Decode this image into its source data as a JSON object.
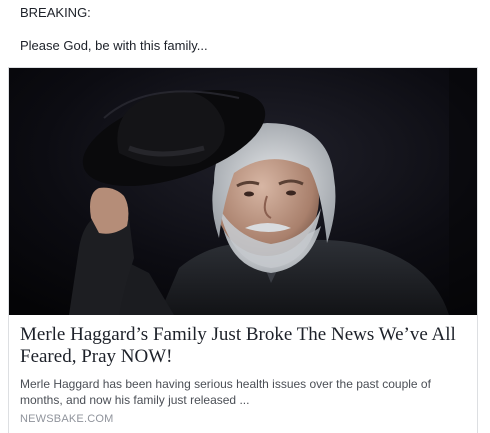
{
  "post": {
    "text_line1": "BREAKING:",
    "text_line2": "Please God, be with this family..."
  },
  "link_card": {
    "image_icon": "photo-icon",
    "title": "Merle Haggard’s Family Just Broke The News We’ve All Feared, Pray NOW!",
    "description": "Merle Haggard has been having serious health issues over the past couple of months, and now his family just released ...",
    "source": "NEWSBAKE.COM"
  },
  "colors": {
    "text": "#1d2129",
    "secondary_text": "#4b4f56",
    "source_text": "#90949c",
    "card_border": "#dddfe2"
  }
}
